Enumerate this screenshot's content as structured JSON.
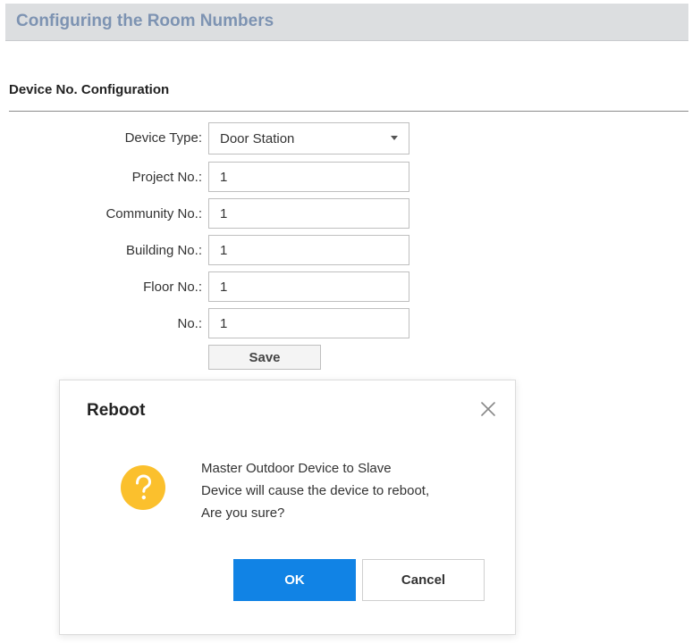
{
  "banner": {
    "title": "Configuring the Room Numbers"
  },
  "section": {
    "title": "Device No. Configuration"
  },
  "form": {
    "device_type": {
      "label": "Device Type:",
      "value": "Door Station",
      "icon": "chevron-down-icon"
    },
    "project_no": {
      "label": "Project No.:",
      "value": "1"
    },
    "community_no": {
      "label": "Community No.:",
      "value": "1"
    },
    "building_no": {
      "label": "Building No.:",
      "value": "1"
    },
    "floor_no": {
      "label": "Floor No.:",
      "value": "1"
    },
    "no": {
      "label": "No.:",
      "value": "1"
    },
    "save_label": "Save"
  },
  "dialog": {
    "title": "Reboot",
    "close_icon": "close-icon",
    "warning_icon": "question-mark-icon",
    "message_lines": [
      "Master Outdoor Device to Slave",
      "Device will cause the device to reboot,",
      "Are you sure?"
    ],
    "ok_label": "OK",
    "cancel_label": "Cancel"
  },
  "colors": {
    "banner_bg": "#dcdee0",
    "banner_text": "#7d93b2",
    "primary": "#1183e5",
    "warning": "#fbc02d"
  }
}
